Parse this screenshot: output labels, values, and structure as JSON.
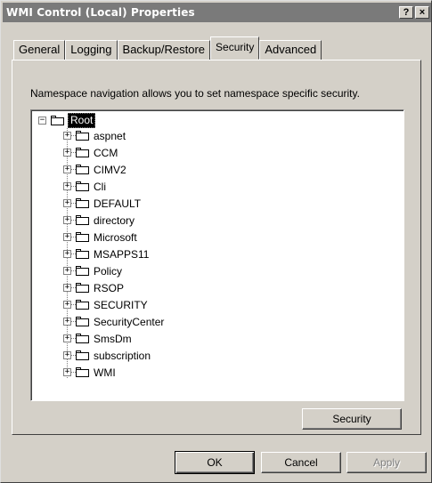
{
  "window": {
    "title": "WMI Control (Local) Properties",
    "help_btn": "?",
    "close_btn": "×"
  },
  "tabs": [
    {
      "label": "General"
    },
    {
      "label": "Logging"
    },
    {
      "label": "Backup/Restore"
    },
    {
      "label": "Security",
      "active": true
    },
    {
      "label": "Advanced"
    }
  ],
  "security_tab": {
    "description": "Namespace navigation allows you to set namespace specific security.",
    "tree": {
      "root": {
        "label": "Root",
        "expander": "−",
        "selected": true
      },
      "children": [
        {
          "label": "aspnet",
          "expander": "+"
        },
        {
          "label": "CCM",
          "expander": "+"
        },
        {
          "label": "CIMV2",
          "expander": "+"
        },
        {
          "label": "Cli",
          "expander": "+"
        },
        {
          "label": "DEFAULT",
          "expander": "+"
        },
        {
          "label": "directory",
          "expander": "+"
        },
        {
          "label": "Microsoft",
          "expander": "+"
        },
        {
          "label": "MSAPPS11",
          "expander": "+"
        },
        {
          "label": "Policy",
          "expander": "+"
        },
        {
          "label": "RSOP",
          "expander": "+"
        },
        {
          "label": "SECURITY",
          "expander": "+"
        },
        {
          "label": "SecurityCenter",
          "expander": "+"
        },
        {
          "label": "SmsDm",
          "expander": "+"
        },
        {
          "label": "subscription",
          "expander": "+"
        },
        {
          "label": "WMI",
          "expander": "+"
        }
      ]
    },
    "security_button": "Security"
  },
  "footer": {
    "ok": "OK",
    "cancel": "Cancel",
    "apply": "Apply"
  },
  "colors": {
    "face": "#d4d0c8",
    "titlebar": "#7a7a7a",
    "selection": "#000000"
  }
}
